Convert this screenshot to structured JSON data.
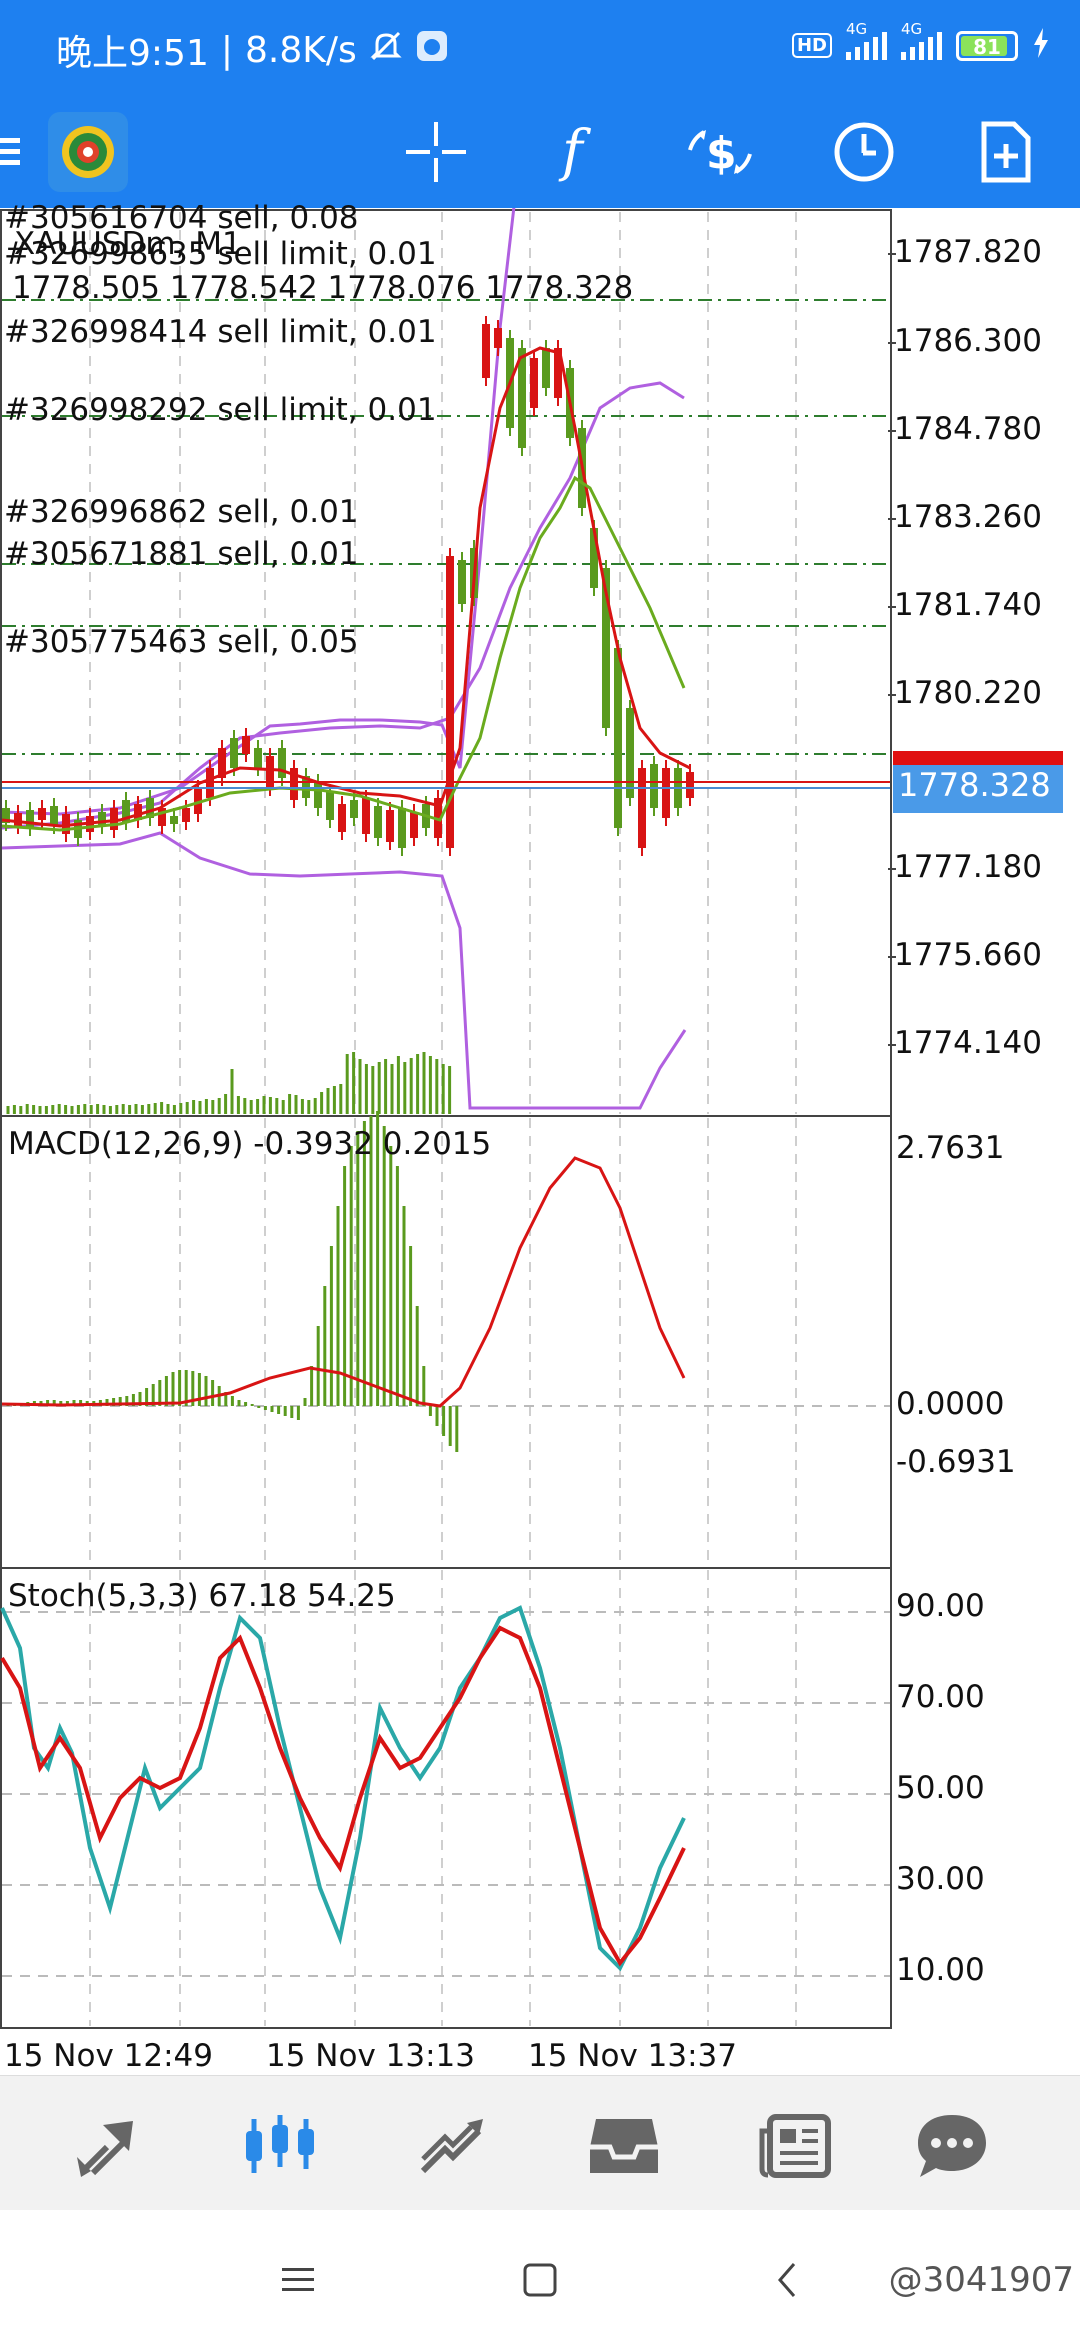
{
  "status_bar": {
    "time": "晚上9:51",
    "speed": "8.8K/s",
    "network1": "4G",
    "network2": "4G",
    "hd": "HD",
    "battery": "81"
  },
  "toolbar": {
    "icons": [
      "menu-icon",
      "app-logo-icon",
      "crosshair-icon",
      "indicators-icon",
      "trade-icon",
      "timeframe-icon",
      "new-order-icon"
    ]
  },
  "chart": {
    "symbol": "XAUUSDm, M1",
    "ohlc": "1778.505 1778.542 1778.076 1778.328",
    "orders": [
      "#305616704 sell, 0.08",
      "#326998635 sell limit, 0.01",
      "#326998414 sell limit, 0.01",
      "#326998292 sell limit, 0.01",
      "#326996862 sell, 0.01",
      "#305671881 sell, 0.01",
      "#305775463 sell, 0.05"
    ],
    "price_axis": [
      "1787.820",
      "1786.300",
      "1784.780",
      "1783.260",
      "1781.740",
      "1780.220",
      "1777.180",
      "1775.660",
      "1774.140"
    ],
    "current_price": "1778.328",
    "current_price_hidden": "1778.505",
    "time_axis": [
      "15 Nov 12:49",
      "15 Nov 13:13",
      "15 Nov 13:37"
    ]
  },
  "macd": {
    "label": "MACD(12,26,9) -0.3932 0.2015",
    "axis": [
      "2.7631",
      "0.0000",
      "-0.6931"
    ]
  },
  "stoch": {
    "label": "Stoch(5,3,3) 67.18 54.25",
    "axis": [
      "90.00",
      "70.00",
      "50.00",
      "30.00",
      "10.00"
    ]
  },
  "bottom_nav": {
    "items": [
      "quotes-icon",
      "chart-icon",
      "trade-icon",
      "history-icon",
      "news-icon",
      "chat-icon"
    ],
    "active": "chart-icon"
  },
  "watermark": "@3041907",
  "colors": {
    "accent": "#1e80f0",
    "bull": "#5a9a1e",
    "bear": "#d81414",
    "ma_fast": "#d81414",
    "ma_slow": "#6aab1e",
    "bands": "#b060e0",
    "stoch_main": "#2aa8a8",
    "stoch_signal": "#d81414",
    "order_line": "#2e7d2e"
  }
}
